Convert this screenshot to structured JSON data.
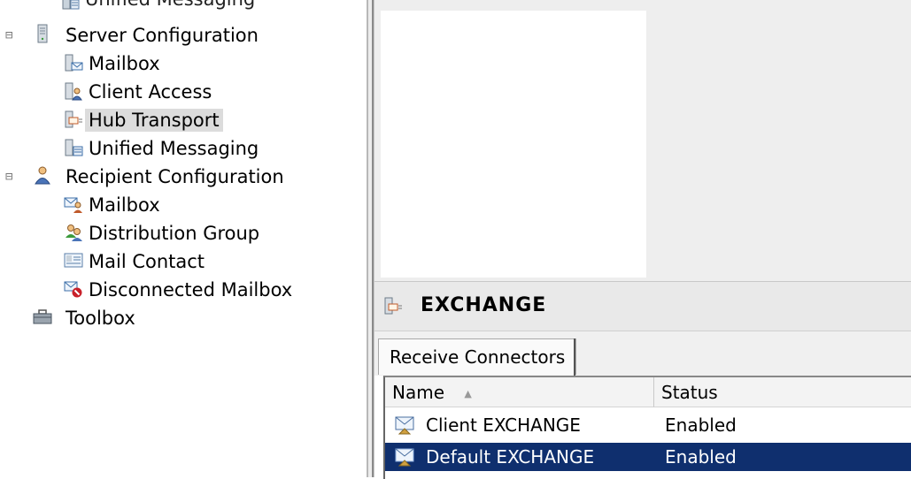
{
  "tree": {
    "top_partial_label": "Unified Messaging",
    "server_configuration": {
      "label": "Server Configuration",
      "expander": "⊟",
      "children": [
        "Mailbox",
        "Client Access",
        "Hub Transport",
        "Unified Messaging"
      ],
      "selected": "Hub Transport"
    },
    "recipient_configuration": {
      "label": "Recipient Configuration",
      "expander": "⊟",
      "children": [
        "Mailbox",
        "Distribution Group",
        "Mail Contact",
        "Disconnected Mailbox"
      ]
    },
    "toolbox": {
      "label": "Toolbox"
    }
  },
  "panel": {
    "title": "EXCHANGE",
    "tabs": [
      "Receive Connectors"
    ],
    "columns": [
      "Name",
      "Status"
    ],
    "sort_indicator": "▲",
    "rows": [
      {
        "name": "Client EXCHANGE",
        "status": "Enabled"
      },
      {
        "name": "Default EXCHANGE",
        "status": "Enabled",
        "selected": true
      }
    ]
  },
  "colors": {
    "selection_background": "#0f2f6e",
    "tree_selection": "#dcdcdc",
    "panel_background": "#eeeeee"
  },
  "icons": {
    "server": "server-icon",
    "mailbox_role": "mailbox-server-icon",
    "client_access": "client-access-icon",
    "hub_transport": "hub-transport-icon",
    "unified_messaging": "unified-messaging-icon",
    "recipient": "recipient-icon",
    "recipient_mailbox": "recipient-mailbox-icon",
    "distribution_group": "distribution-group-icon",
    "mail_contact": "mail-contact-icon",
    "disconnected_mailbox": "disconnected-mailbox-icon",
    "toolbox": "toolbox-icon",
    "connector": "receive-connector-icon"
  }
}
